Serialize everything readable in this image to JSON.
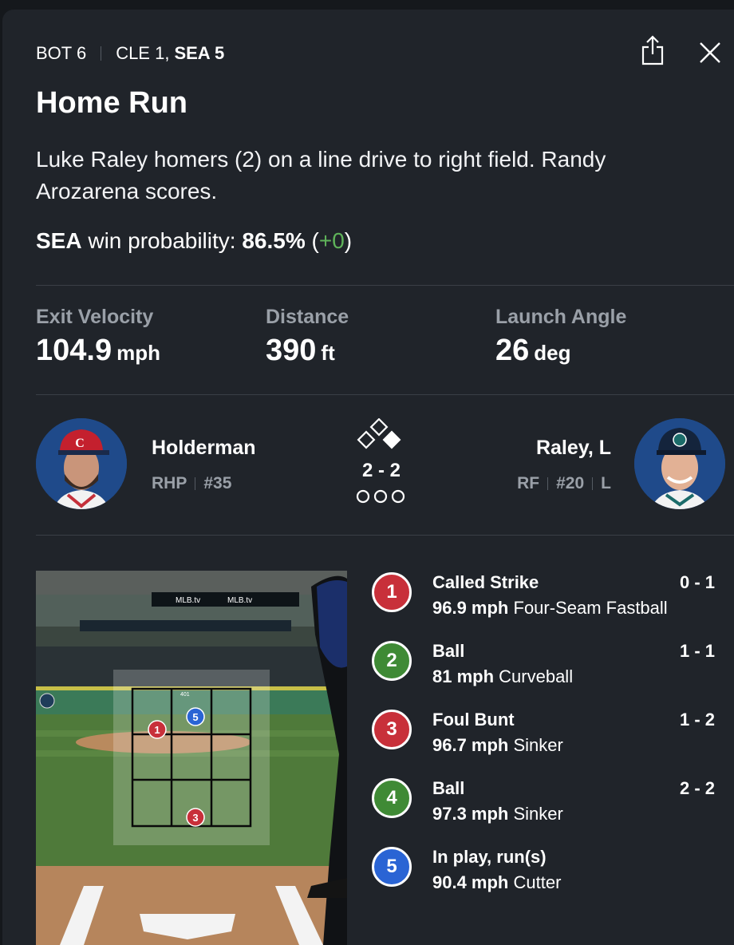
{
  "header": {
    "inning": "BOT 6",
    "away": "CLE 1,",
    "home": "SEA 5"
  },
  "play": {
    "title": "Home Run",
    "description": "Luke Raley homers (2) on a line drive to right field. Randy Arozarena scores."
  },
  "win_probability": {
    "team": "SEA",
    "label": " win probability: ",
    "value": "86.5%",
    "open": " (",
    "change": "+0",
    "close": ")"
  },
  "stats": [
    {
      "label": "Exit Velocity",
      "value": "104.9",
      "unit": "mph"
    },
    {
      "label": "Distance",
      "value": "390",
      "unit": "ft"
    },
    {
      "label": "Launch Angle",
      "value": "26",
      "unit": "deg"
    }
  ],
  "pitcher": {
    "name": "Holderman",
    "position": "RHP",
    "number": "#35"
  },
  "batter": {
    "name": "Raley, L",
    "position": "RF",
    "number": "#20",
    "bats": "L"
  },
  "situation": {
    "count": "2 - 2"
  },
  "stadium_text": {
    "ad1": "MLB.tv",
    "ad2": "MLB.tv",
    "zone_label": "401"
  },
  "pitches": [
    {
      "num": "1",
      "call": "Called Strike",
      "count": "0 - 1",
      "speed": "96.9 mph",
      "type": "Four-Seam Fastball",
      "color": "#c8303a"
    },
    {
      "num": "2",
      "call": "Ball",
      "count": "1 - 1",
      "speed": "81 mph",
      "type": "Curveball",
      "color": "#3f8a35"
    },
    {
      "num": "3",
      "call": "Foul Bunt",
      "count": "1 - 2",
      "speed": "96.7 mph",
      "type": "Sinker",
      "color": "#c8303a"
    },
    {
      "num": "4",
      "call": "Ball",
      "count": "2 - 2",
      "speed": "97.3 mph",
      "type": "Sinker",
      "color": "#3f8a35"
    },
    {
      "num": "5",
      "call": "In play, run(s)",
      "count": "",
      "speed": "90.4 mph",
      "type": "Cutter",
      "color": "#2a64d4"
    }
  ],
  "colors": {
    "panel": "#20242a",
    "muted": "#9aa0a8",
    "green": "#5fb35a"
  },
  "icons": [
    "share-icon",
    "close-icon",
    "cleveland-cap-avatar",
    "seattle-cap-avatar",
    "bases-diamond-icon",
    "outs-icon"
  ]
}
